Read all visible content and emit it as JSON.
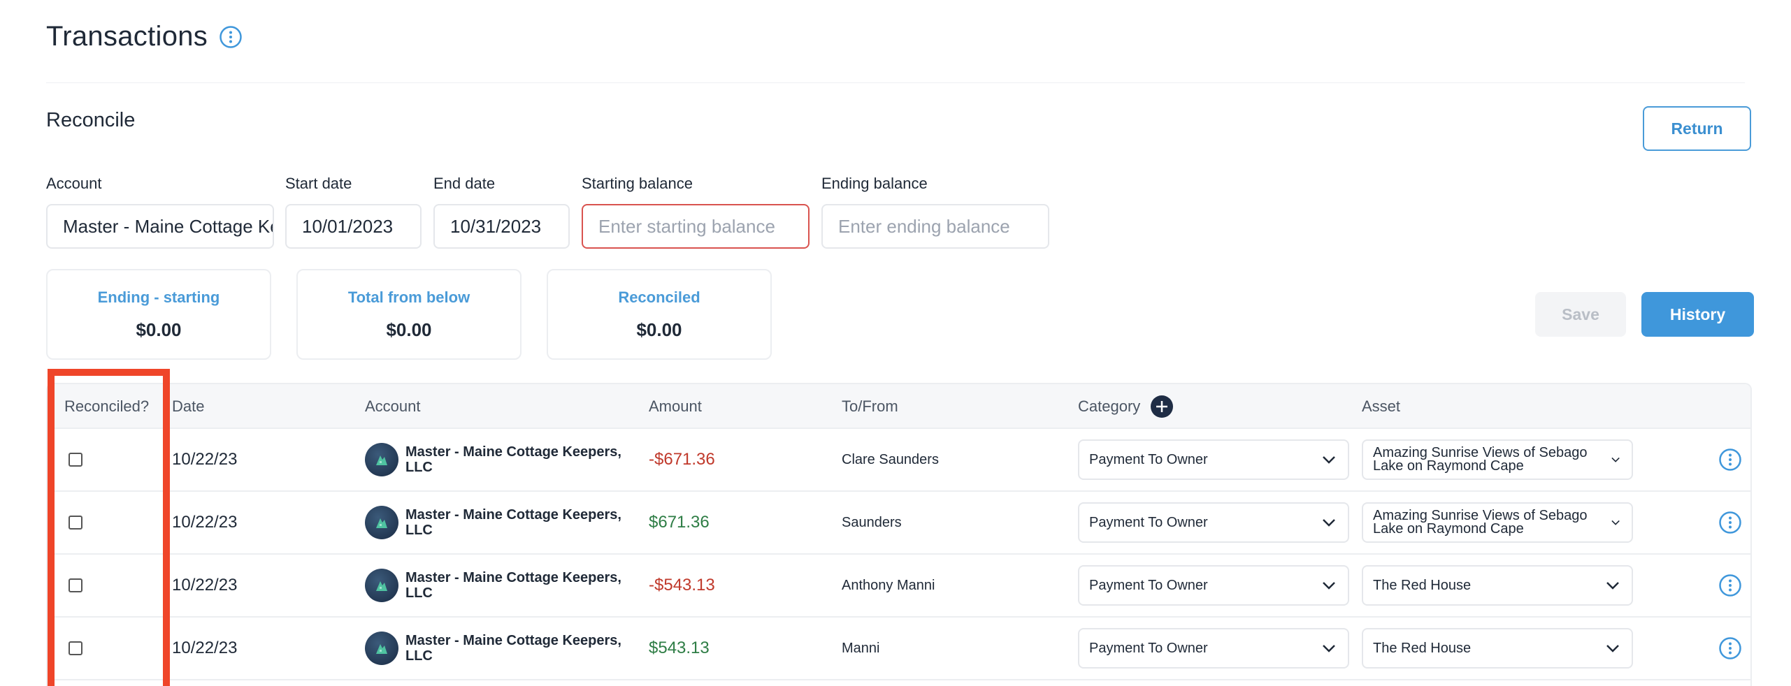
{
  "page": {
    "title": "Transactions",
    "info_icon": "info-circle-icon"
  },
  "reconcile": {
    "section_title": "Reconcile",
    "return_label": "Return",
    "fields": {
      "account": {
        "label": "Account",
        "value": "Master - Maine Cottage Keepers, LLC"
      },
      "start_date": {
        "label": "Start date",
        "value": "10/01/2023"
      },
      "end_date": {
        "label": "End date",
        "value": "10/31/2023"
      },
      "starting_balance": {
        "label": "Starting balance",
        "placeholder": "Enter starting balance"
      },
      "ending_balance": {
        "label": "Ending balance",
        "placeholder": "Enter ending balance"
      }
    },
    "stats": [
      {
        "label": "Ending - starting",
        "value": "$0.00"
      },
      {
        "label": "Total from below",
        "value": "$0.00"
      },
      {
        "label": "Reconciled",
        "value": "$0.00"
      }
    ],
    "save_label": "Save",
    "history_label": "History"
  },
  "table": {
    "headers": {
      "reconciled": "Reconciled?",
      "date": "Date",
      "account": "Account",
      "amount": "Amount",
      "tofrom": "To/From",
      "category": "Category",
      "asset": "Asset"
    },
    "rows": [
      {
        "date": "10/22/23",
        "account": "Master - Maine Cottage Keepers, LLC",
        "amount": "-$671.36",
        "sign": "neg",
        "tofrom": "Clare Saunders",
        "category": "Payment To Owner",
        "asset": "Amazing Sunrise Views of Sebago Lake on Raymond Cape"
      },
      {
        "date": "10/22/23",
        "account": "Master - Maine Cottage Keepers, LLC",
        "amount": "$671.36",
        "sign": "pos",
        "tofrom": "Saunders",
        "category": "Payment To Owner",
        "asset": "Amazing Sunrise Views of Sebago Lake on Raymond Cape"
      },
      {
        "date": "10/22/23",
        "account": "Master - Maine Cottage Keepers, LLC",
        "amount": "-$543.13",
        "sign": "neg",
        "tofrom": "Anthony Manni",
        "category": "Payment To Owner",
        "asset": "The Red House"
      },
      {
        "date": "10/22/23",
        "account": "Master - Maine Cottage Keepers, LLC",
        "amount": "$543.13",
        "sign": "pos",
        "tofrom": "Manni",
        "category": "Payment To Owner",
        "asset": "The Red House"
      }
    ]
  },
  "colors": {
    "accent": "#3f97db",
    "negative": "#c0392b",
    "positive": "#2e7d45",
    "highlight": "#ef4529",
    "error_border": "#d9534f"
  }
}
